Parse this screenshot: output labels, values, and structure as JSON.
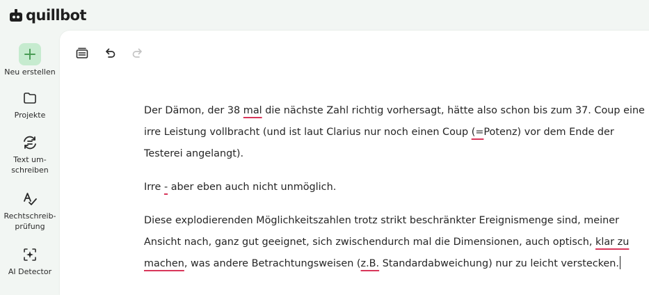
{
  "app": {
    "logo_text": "quillbot"
  },
  "sidebar": {
    "items": [
      {
        "label_line1": "Neu erstellen",
        "label_line2": "",
        "icon": "plus-icon"
      },
      {
        "label_line1": "Projekte",
        "label_line2": "",
        "icon": "folder-icon"
      },
      {
        "label_line1": "Text um-",
        "label_line2": "schreiben",
        "icon": "paraphrase-icon"
      },
      {
        "label_line1": "Rechtschreib-",
        "label_line2": "prüfung",
        "icon": "spellcheck-icon"
      },
      {
        "label_line1": "AI Detector",
        "label_line2": "",
        "icon": "ai-detector-icon"
      }
    ]
  },
  "toolbar": {
    "icons": [
      "document-history-icon",
      "undo-icon",
      "redo-icon"
    ]
  },
  "document": {
    "p1": {
      "s1": "Der Dämon, der 38 ",
      "e1": "mal",
      "s2": " die nächste Zahl richtig vorhersagt, hätte also schon bis zum 37. Coup eine irre Leistung vollbracht (und ist laut Clarius nur noch einen Coup ",
      "e2": "(=",
      "s3": "Potenz) vor dem Ende der Testerei angelangt)."
    },
    "p2": {
      "s1": "Irre ",
      "e1": "-",
      "s2": " aber eben auch nicht unmöglich."
    },
    "p3": {
      "s1": "Diese explodierenden Möglichkeitszahlen trotz strikt beschränkter Ereignismenge sind, meiner Ansicht nach, ganz gut geeignet, sich zwischendurch mal die Dimensionen, auch optisch, ",
      "e1": "klar zu machen",
      "s2": ", was andere Betrachtungsweisen (",
      "e2": "z.B.",
      "s3": " Standardabweichung) nur zu leicht verstecken."
    }
  },
  "colors": {
    "accent": "#499c55",
    "error_underline": "#d8365a",
    "sidebar_bg": "#f2f6f3",
    "new_button_bg": "#c6ebcf"
  }
}
